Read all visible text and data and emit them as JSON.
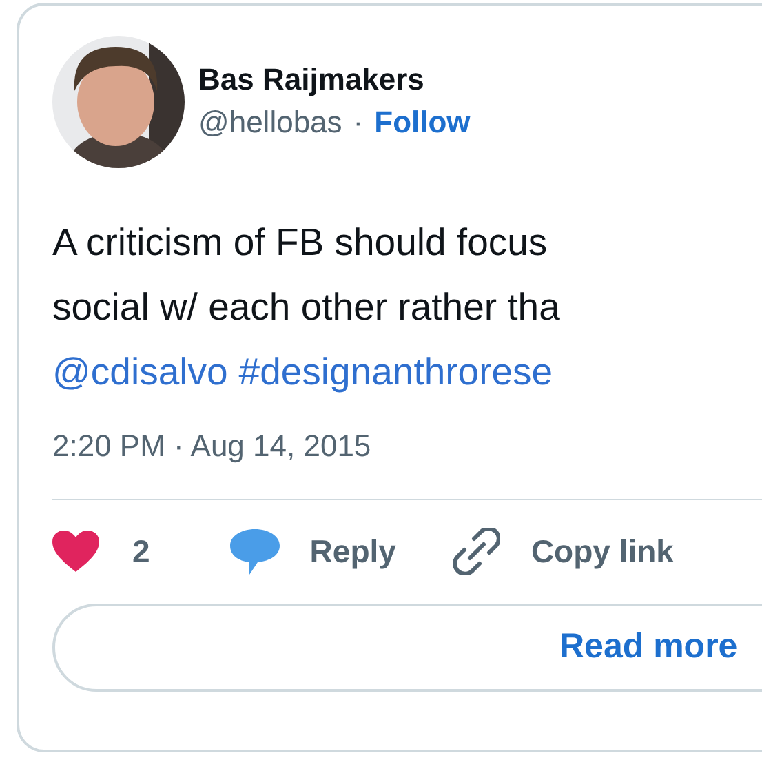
{
  "author": {
    "name": "Bas Raijmakers",
    "handle": "@hellobas",
    "separator": "·",
    "follow": "Follow"
  },
  "text_lines": [
    [
      {
        "kind": "text",
        "text": "A criticism of FB should focus"
      }
    ],
    [
      {
        "kind": "text",
        "text": "social w/ each other rather tha"
      }
    ],
    [
      {
        "kind": "mention",
        "text": "@cdisalvo"
      },
      {
        "kind": "hashtag",
        "text": "#designanthrorese"
      }
    ]
  ],
  "timestamp": "2:20 PM · Aug 14, 2015",
  "actions": [
    {
      "kind": "like",
      "label": "2"
    },
    {
      "kind": "reply",
      "label": "Reply"
    },
    {
      "kind": "copy",
      "label": "Copy link"
    }
  ],
  "read_more": "Read more"
}
